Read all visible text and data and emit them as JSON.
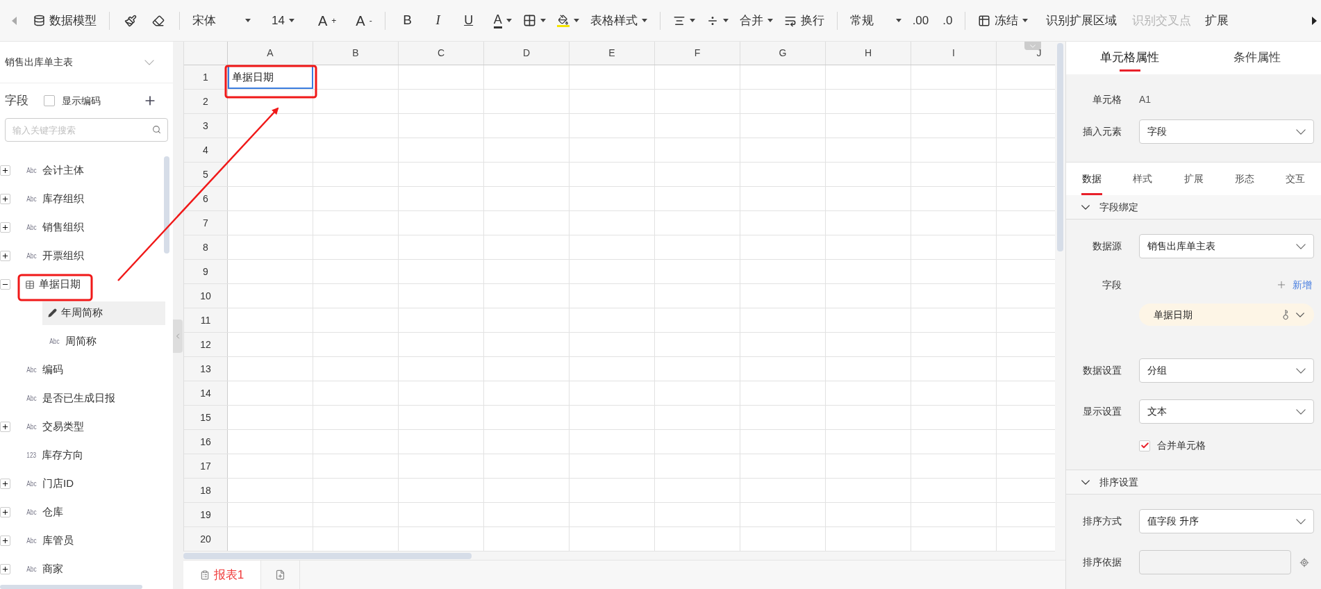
{
  "toolbar": {
    "data_model": "数据模型",
    "font": "宋体",
    "font_size": "14",
    "grow_font": "A",
    "grow_sign": "+",
    "shrink_font": "A",
    "shrink_sign": "-",
    "bold": "B",
    "italic": "I",
    "underline": "U",
    "font_color": "A",
    "table_style": "表格样式",
    "merge": "合并",
    "wrap": "换行",
    "number_format": "常规",
    "decimals_add": ".00",
    "decimals_remove": ".0",
    "freeze": "冻结",
    "detect_area": "识别扩展区域",
    "detect_cross": {
      "label": "识别交叉点",
      "disabled": true
    },
    "extend": "扩展"
  },
  "left_panel": {
    "dataset": "销售出库单主表",
    "fields_title": "字段",
    "show_code": {
      "label": "显示编码",
      "checked": false
    },
    "search": {
      "placeholder": "输入关键字搜索"
    },
    "fields": [
      {
        "kind": "text",
        "type_label": "Abc",
        "label": "会计主体",
        "expanded": false,
        "selected": false
      },
      {
        "kind": "text",
        "type_label": "Abc",
        "label": "库存组织",
        "expanded": false,
        "selected": false
      },
      {
        "kind": "text",
        "type_label": "Abc",
        "label": "销售组织",
        "expanded": false,
        "selected": false
      },
      {
        "kind": "text",
        "type_label": "Abc",
        "label": "开票组织",
        "expanded": false,
        "selected": false
      },
      {
        "kind": "table",
        "label": "单据日期",
        "expanded": true,
        "selected": false,
        "children": [
          {
            "kind": "edit",
            "label": "年周简称",
            "selected": true
          },
          {
            "kind": "text",
            "type_label": "Abc",
            "label": "周简称",
            "selected": false
          }
        ]
      },
      {
        "kind": "text",
        "type_label": "Abc",
        "label": "编码",
        "selected": false
      },
      {
        "kind": "text",
        "type_label": "Abc",
        "label": "是否已生成日报",
        "selected": false
      },
      {
        "kind": "text",
        "type_label": "Abc",
        "label": "交易类型",
        "expanded": false,
        "selected": false
      },
      {
        "kind": "text",
        "type_label": "123",
        "label": "库存方向",
        "selected": false
      },
      {
        "kind": "text",
        "type_label": "Abc",
        "label": "门店ID",
        "expanded": false,
        "selected": false
      },
      {
        "kind": "text",
        "type_label": "Abc",
        "label": "仓库",
        "expanded": false,
        "selected": false
      },
      {
        "kind": "text",
        "type_label": "Abc",
        "label": "库管员",
        "expanded": false,
        "selected": false
      },
      {
        "kind": "text",
        "type_label": "Abc",
        "label": "商家",
        "expanded": false,
        "selected": false
      }
    ]
  },
  "grid": {
    "columns": [
      "A",
      "B",
      "C",
      "D",
      "E",
      "F",
      "G",
      "H",
      "I",
      "J"
    ],
    "rows": [
      {
        "label": "1",
        "cells": [
          {
            "text": "单据日期",
            "selected": true
          }
        ]
      },
      {
        "label": "2"
      },
      {
        "label": "3"
      },
      {
        "label": "4"
      },
      {
        "label": "5"
      },
      {
        "label": "6"
      },
      {
        "label": "7"
      },
      {
        "label": "8"
      },
      {
        "label": "9"
      },
      {
        "label": "10"
      },
      {
        "label": "11"
      },
      {
        "label": "12"
      },
      {
        "label": "13"
      },
      {
        "label": "14"
      },
      {
        "label": "15"
      },
      {
        "label": "16"
      },
      {
        "label": "17"
      },
      {
        "label": "18"
      },
      {
        "label": "19"
      },
      {
        "label": "20"
      }
    ]
  },
  "sheet_tabs": [
    {
      "label": "报表1",
      "selected": true
    }
  ],
  "right_panel": {
    "tabs": [
      {
        "label": "单元格属性",
        "selected": true
      },
      {
        "label": "条件属性",
        "selected": false
      }
    ],
    "cell": {
      "label": "单元格",
      "value": "A1"
    },
    "insert_element": {
      "label": "插入元素",
      "value": "字段"
    },
    "subtabs": [
      {
        "label": "数据",
        "selected": true
      },
      {
        "label": "样式",
        "selected": false
      },
      {
        "label": "扩展",
        "selected": false
      },
      {
        "label": "形态",
        "selected": false
      },
      {
        "label": "交互",
        "selected": false
      }
    ],
    "binding": {
      "title": "字段绑定",
      "expanded": true,
      "source_label": "数据源",
      "source": "销售出库单主表",
      "field_label": "字段",
      "add": "新增",
      "field_chip": "单据日期",
      "data_setting_label": "数据设置",
      "data_setting": "分组",
      "display_label": "显示设置",
      "display": "文本",
      "merge": {
        "label": "合并单元格",
        "checked": true
      }
    },
    "sorting": {
      "title": "排序设置",
      "expanded": true,
      "method_label": "排序方式",
      "method": "值字段 升序",
      "basis_label": "排序依据"
    }
  }
}
